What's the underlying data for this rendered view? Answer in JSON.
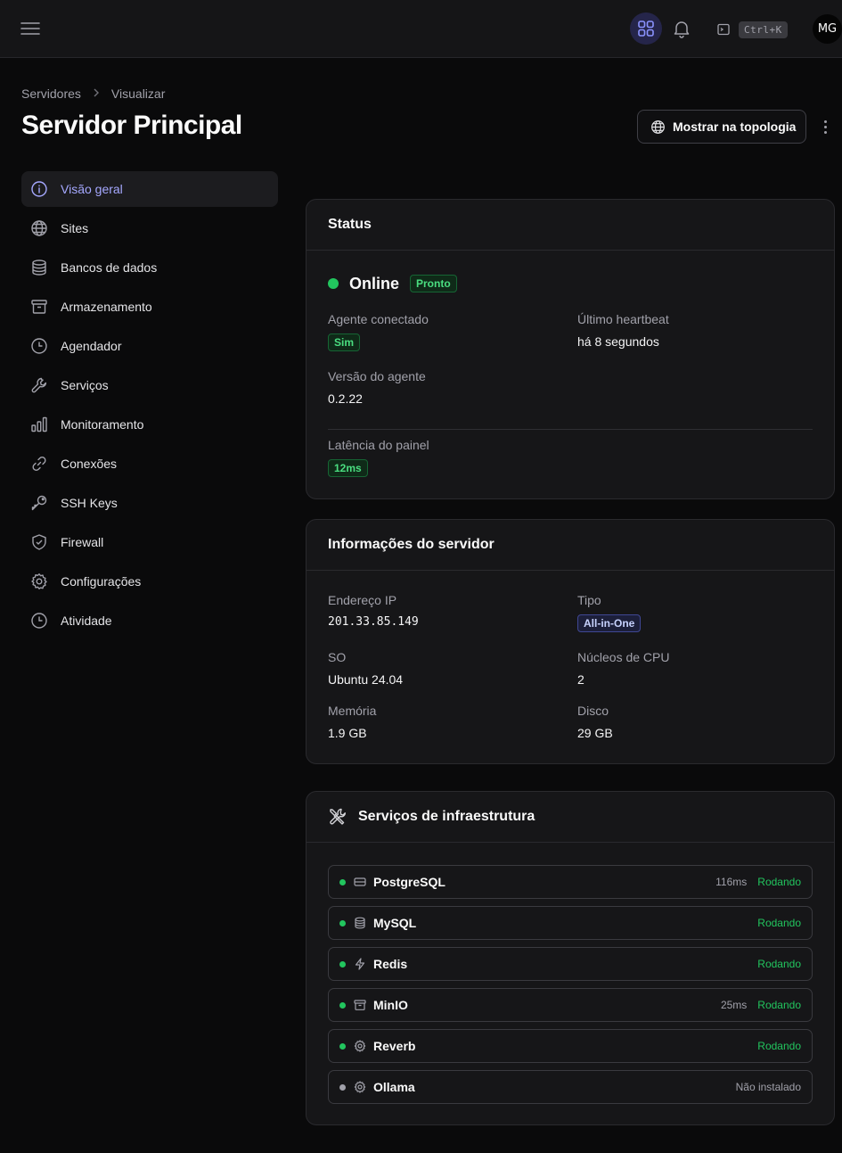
{
  "header": {
    "shortcut": "Ctrl+K",
    "avatar_initials": "MG",
    "accent_color": "#818cf8"
  },
  "breadcrumb": [
    "Servidores",
    "Visualizar"
  ],
  "page_title": "Servidor Principal",
  "actions": {
    "topology_label": "Mostrar na topologia"
  },
  "sidebar": {
    "items": [
      {
        "label": "Visão geral",
        "icon": "info-icon",
        "active": true
      },
      {
        "label": "Sites",
        "icon": "globe-icon"
      },
      {
        "label": "Bancos de dados",
        "icon": "database-icon"
      },
      {
        "label": "Armazenamento",
        "icon": "archive-icon"
      },
      {
        "label": "Agendador",
        "icon": "clock-icon"
      },
      {
        "label": "Serviços",
        "icon": "wrench-icon"
      },
      {
        "label": "Monitoramento",
        "icon": "bar-chart-icon"
      },
      {
        "label": "Conexões",
        "icon": "link-icon"
      },
      {
        "label": "SSH Keys",
        "icon": "key-icon"
      },
      {
        "label": "Firewall",
        "icon": "shield-icon"
      },
      {
        "label": "Configurações",
        "icon": "gear-icon"
      },
      {
        "label": "Atividade",
        "icon": "clock-icon"
      }
    ]
  },
  "status": {
    "title": "Status",
    "state": "Online",
    "state_badge": "Pronto",
    "agent_connected_label": "Agente conectado",
    "agent_connected_value": "Sim",
    "heartbeat_label": "Último heartbeat",
    "heartbeat_value": "há 8 segundos",
    "agent_version_label": "Versão do agente",
    "agent_version_value": "0.2.22",
    "latency_label": "Latência do painel",
    "latency_value": "12ms"
  },
  "server_info": {
    "title": "Informações do servidor",
    "ip_label": "Endereço IP",
    "ip_value": "201.33.85.149",
    "type_label": "Tipo",
    "type_value": "All-in-One",
    "os_label": "SO",
    "os_value": "Ubuntu 24.04",
    "cpu_label": "Núcleos de CPU",
    "cpu_value": "2",
    "memory_label": "Memória",
    "memory_value": "1.9 GB",
    "disk_label": "Disco",
    "disk_value": "29 GB"
  },
  "infra": {
    "title": "Serviços de infraestrutura",
    "services": [
      {
        "name": "PostgreSQL",
        "icon": "server-icon",
        "latency": "116ms",
        "status": "Rodando",
        "running": true
      },
      {
        "name": "MySQL",
        "icon": "database-icon",
        "latency": "",
        "status": "Rodando",
        "running": true
      },
      {
        "name": "Redis",
        "icon": "bolt-icon",
        "latency": "",
        "status": "Rodando",
        "running": true
      },
      {
        "name": "MinIO",
        "icon": "archive-icon",
        "latency": "25ms",
        "status": "Rodando",
        "running": true
      },
      {
        "name": "Reverb",
        "icon": "gear-icon",
        "latency": "",
        "status": "Rodando",
        "running": true
      },
      {
        "name": "Ollama",
        "icon": "gear-icon",
        "latency": "",
        "status": "Não instalado",
        "running": false
      }
    ]
  }
}
